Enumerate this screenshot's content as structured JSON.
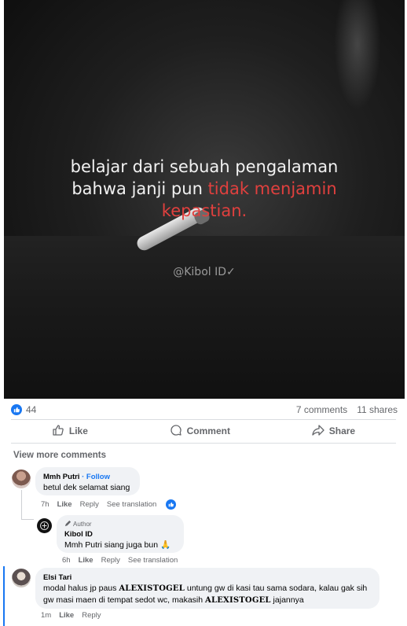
{
  "post": {
    "quote_line1": "belajar dari sebuah pengalaman",
    "quote_line2_a": "bahwa janji pun ",
    "quote_line2_b": "tidak menjamin",
    "quote_line3": "kepastian.",
    "watermark": "@Kibol ID✓"
  },
  "stats": {
    "reactions": "44",
    "comments": "7 comments",
    "shares": "11 shares"
  },
  "actions": {
    "like": "Like",
    "comment": "Comment",
    "share": "Share"
  },
  "view_more": "View more comments",
  "comments": [
    {
      "name": "Mmh Putri",
      "follow": " · Follow",
      "text": "betul dek selamat siang",
      "time": "7h",
      "like": "Like",
      "reply": "Reply",
      "translate": "See translation"
    },
    {
      "author_tag": "Author",
      "name": "Kibol ID",
      "mention": "Mmh Putri",
      "text": " siang juga bun 🙏",
      "time": "6h",
      "like": "Like",
      "reply": "Reply",
      "translate": "See translation"
    },
    {
      "name": "Elsi Tari",
      "text_a": "modal halus jp paus ",
      "brand1": "ALEXISTOGEL",
      "text_b": " untung gw di kasi tau sama sodara, kalau gak sih",
      "text_c": "gw masi maen di tempat sedot wc, makasih ",
      "brand2": "ALEXISTOGEL",
      "text_d": " jajannya",
      "time": "1m",
      "like": "Like",
      "reply": "Reply"
    }
  ],
  "colors": {
    "accent": "#1877f2",
    "quote_highlight": "#e0403e",
    "bubble": "#f0f2f5",
    "muted_text": "#65676b"
  }
}
